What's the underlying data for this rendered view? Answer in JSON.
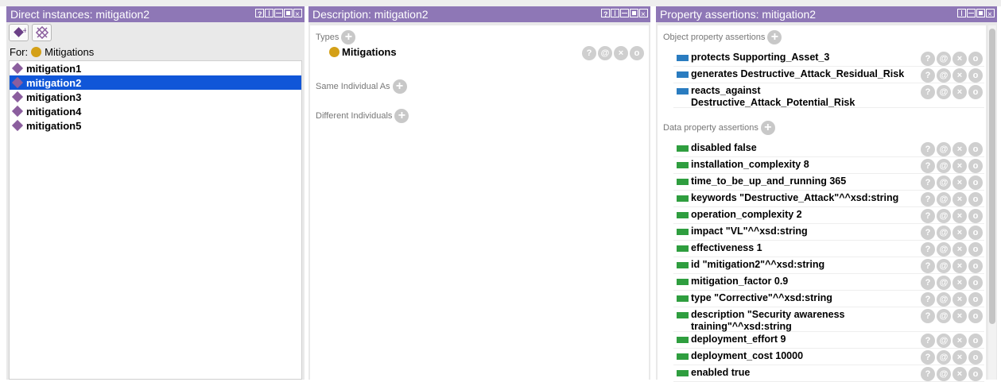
{
  "panels": {
    "instances": {
      "title": "Direct instances: mitigation2",
      "for_label": "For:",
      "for_class": "Mitigations",
      "items": [
        "mitigation1",
        "mitigation2",
        "mitigation3",
        "mitigation4",
        "mitigation5"
      ],
      "selected": "mitigation2"
    },
    "description": {
      "title": "Description: mitigation2",
      "types_label": "Types",
      "type_value": "Mitigations",
      "same_label": "Same Individual As",
      "different_label": "Different Individuals"
    },
    "properties": {
      "title": "Property assertions: mitigation2",
      "object_label": "Object property assertions",
      "data_label": "Data property assertions",
      "object_assertions": [
        "protects  Supporting_Asset_3",
        "generates  Destructive_Attack_Residual_Risk",
        "reacts_against  Destructive_Attack_Potential_Risk"
      ],
      "data_assertions": [
        "disabled  false",
        "installation_complexity  8",
        "time_to_be_up_and_running  365",
        "keywords  \"Destructive_Attack\"^^xsd:string",
        "operation_complexity  2",
        "impact  \"VL\"^^xsd:string",
        "effectiveness  1",
        "id  \"mitigation2\"^^xsd:string",
        "mitigation_factor  0.9",
        "type  \"Corrective\"^^xsd:string",
        "description  \"Security awareness training\"^^xsd:string",
        "deployment_effort  9",
        "deployment_cost  10000",
        "enabled  true"
      ]
    }
  },
  "action_glyphs": {
    "help": "?",
    "annotate": "@",
    "delete": "×",
    "edit": "o"
  },
  "icons": {
    "add": "+"
  },
  "colors": {
    "title_bar": "#8e77b6",
    "selection": "#1056d8",
    "class_dot": "#d4a017",
    "individual": "#8b5e9e",
    "object_prop": "#2a7cc0",
    "data_prop": "#2f9e3f"
  }
}
